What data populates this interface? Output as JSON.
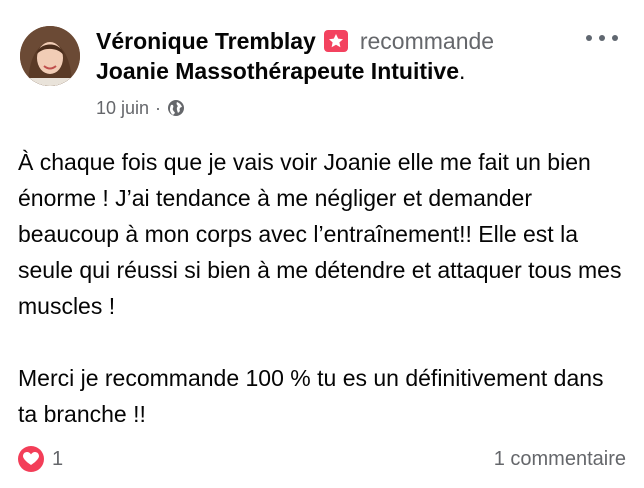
{
  "post": {
    "author": "Véronique Tremblay",
    "action": "recommande",
    "page": "Joanie Massothérapeute Intuitive",
    "page_suffix": ".",
    "date": "10 juin",
    "separator": "·",
    "privacy_icon": "globe-icon",
    "recommend_icon": "recommend-badge-icon",
    "more_icon": "more-horizontal-icon",
    "paragraphs": [
      "À chaque fois que je vais voir Joanie elle me fait un bien énorme ! J’ai tendance à me négliger et demander beaucoup à mon corps avec l’entraînement!! Elle est la seule qui réussi si bien à me détendre et attaquer tous mes muscles !",
      "Merci je recommande 100 % tu es un définitivement dans ta branche !!"
    ]
  },
  "footer": {
    "reaction_icon": "heart-icon",
    "reaction_count": "1",
    "comments": "1 commentaire"
  },
  "colors": {
    "text": "#050505",
    "secondary": "#65676b",
    "recommend_red": "#f3425f",
    "heart_red": "#f33e58"
  }
}
